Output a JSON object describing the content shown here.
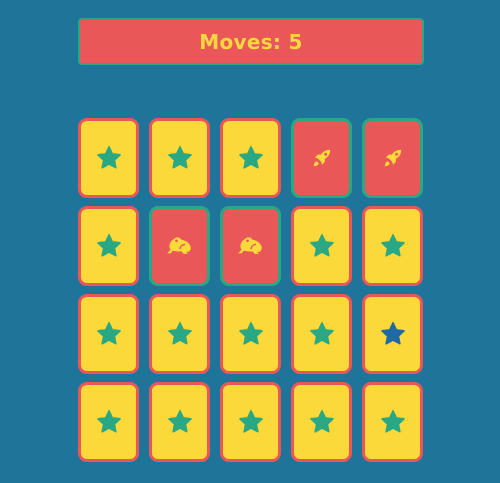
{
  "header": {
    "moves_text": "Moves: 5"
  },
  "colors": {
    "background": "#1f7499",
    "banner": "#ea5759",
    "banner_text": "#f9d73f",
    "card_back": "#fcd93a",
    "card_back_border": "#ea5759",
    "card_face": "#ea5759",
    "card_face_border": "#2aa883",
    "star": "#2aa883",
    "star_highlight": "#1f6aa5",
    "face_icon": "#fcd93a"
  },
  "board": {
    "rows": 4,
    "cols": 5,
    "cards": [
      {
        "state": "face-down",
        "icon": "star-icon"
      },
      {
        "state": "face-down",
        "icon": "star-icon"
      },
      {
        "state": "face-down",
        "icon": "star-icon"
      },
      {
        "state": "face-up",
        "icon": "rocket-icon"
      },
      {
        "state": "face-up",
        "icon": "rocket-icon"
      },
      {
        "state": "face-down",
        "icon": "star-icon"
      },
      {
        "state": "face-up",
        "icon": "frog-icon"
      },
      {
        "state": "face-up",
        "icon": "frog-icon"
      },
      {
        "state": "face-down",
        "icon": "star-icon"
      },
      {
        "state": "face-down",
        "icon": "star-icon"
      },
      {
        "state": "face-down",
        "icon": "star-icon"
      },
      {
        "state": "face-down",
        "icon": "star-icon"
      },
      {
        "state": "face-down",
        "icon": "star-icon"
      },
      {
        "state": "face-down",
        "icon": "star-icon"
      },
      {
        "state": "face-down",
        "icon": "star-icon",
        "highlighted": true
      },
      {
        "state": "face-down",
        "icon": "star-icon"
      },
      {
        "state": "face-down",
        "icon": "star-icon"
      },
      {
        "state": "face-down",
        "icon": "star-icon"
      },
      {
        "state": "face-down",
        "icon": "star-icon"
      },
      {
        "state": "face-down",
        "icon": "star-icon"
      }
    ]
  }
}
